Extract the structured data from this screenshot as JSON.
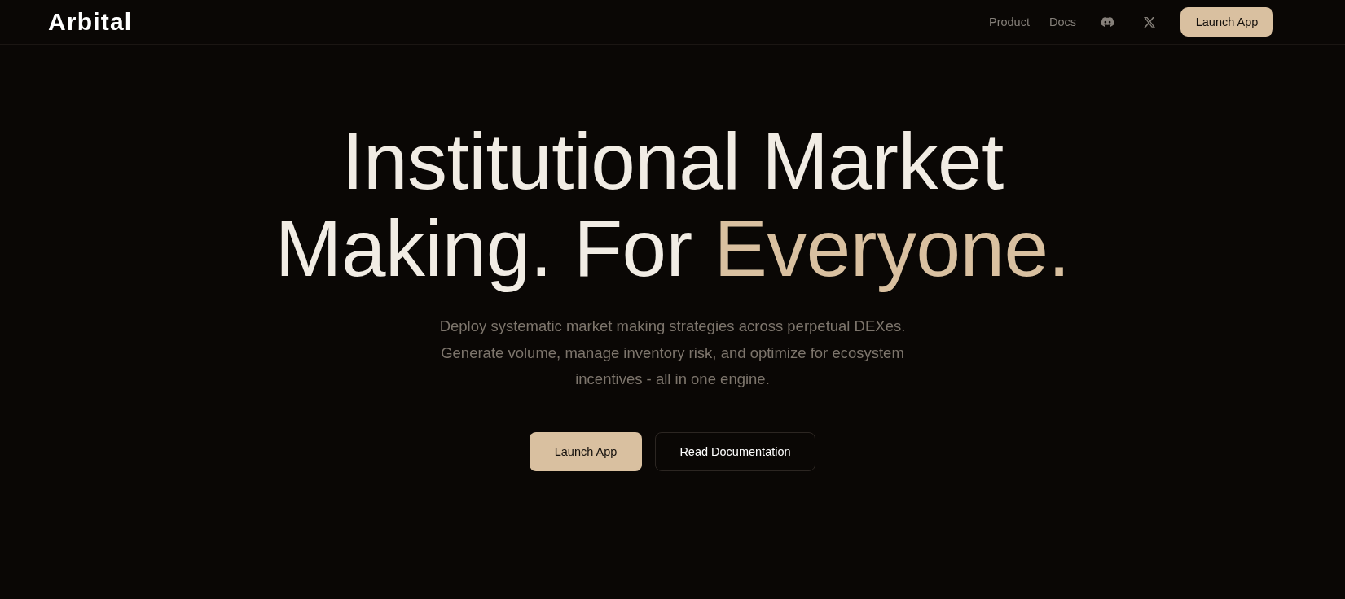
{
  "header": {
    "logo": "Arbital",
    "nav_links": [
      "Product",
      "Docs"
    ],
    "cta": "Launch App"
  },
  "hero": {
    "headline": [
      {
        "text": "Institutional Market Making. For ",
        "accent": false
      },
      {
        "text": "Everyone.",
        "accent": true
      }
    ],
    "subtitle": "Deploy systematic market making strategies across perpetual DEXes. Generate volume, manage inventory risk, and optimize for ecosystem incentives - all in one engine.",
    "buttons": [
      {
        "label": "Launch App",
        "kind": "primary"
      },
      {
        "label": "Read Documentation",
        "kind": "secondary"
      }
    ]
  }
}
